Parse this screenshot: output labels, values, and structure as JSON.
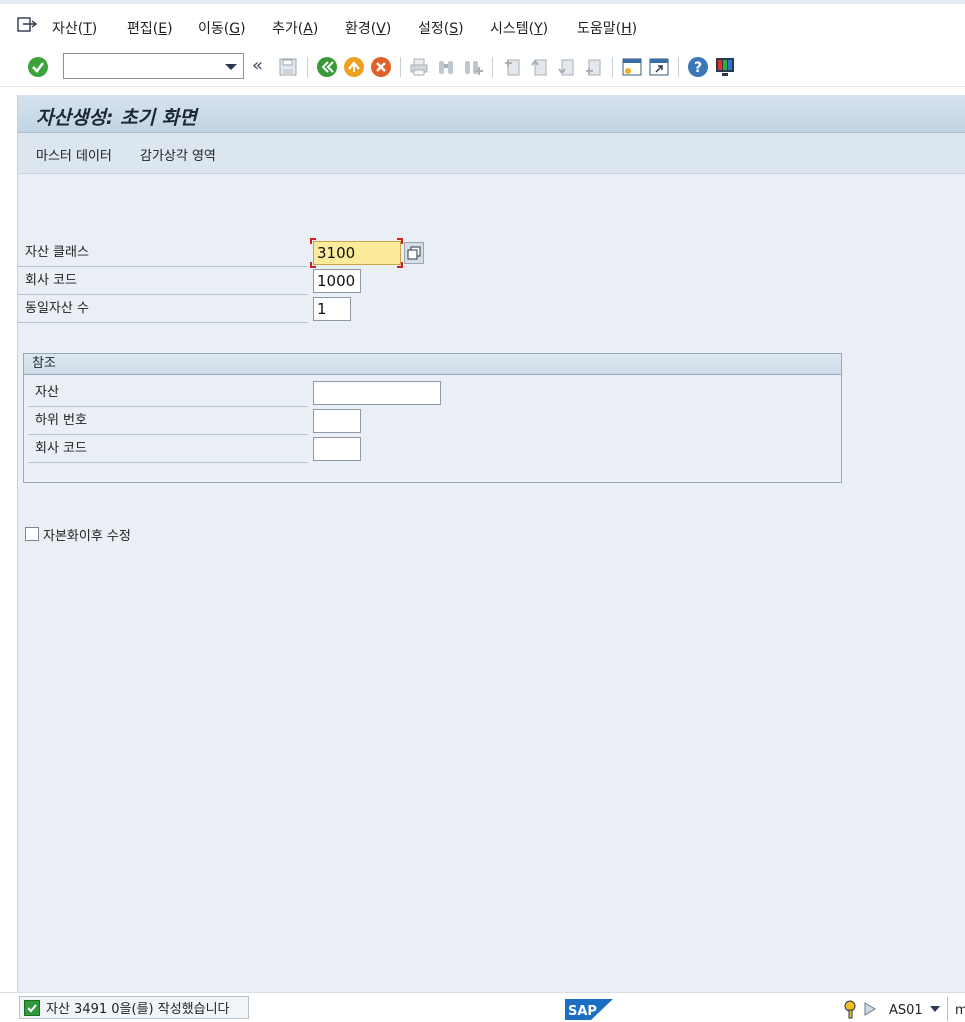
{
  "menubar": {
    "items": [
      {
        "label": "자산(",
        "accel": "T",
        "end": ")"
      },
      {
        "label": "편집(",
        "accel": "E",
        "end": ")"
      },
      {
        "label": "이동(",
        "accel": "G",
        "end": ")"
      },
      {
        "label": "추가(",
        "accel": "A",
        "end": ")"
      },
      {
        "label": "환경(",
        "accel": "V",
        "end": ")"
      },
      {
        "label": "설정(",
        "accel": "S",
        "end": ")"
      },
      {
        "label": "시스템(",
        "accel": "Y",
        "end": ")"
      },
      {
        "label": "도움말(",
        "accel": "H",
        "end": ")"
      }
    ]
  },
  "toolbar": {
    "command_value": "",
    "back_symbol": "«"
  },
  "screen": {
    "title": "자산생성: 초기 화면",
    "app_buttons": [
      "마스터 데이터",
      "감가상각 영역"
    ]
  },
  "fields": {
    "asset_class": {
      "label": "자산 클래스",
      "value": "3100"
    },
    "company_code": {
      "label": "회사 코드",
      "value": "1000"
    },
    "num_similar": {
      "label": "동일자산 수",
      "value": "1"
    }
  },
  "reference": {
    "title": "참조",
    "asset": {
      "label": "자산",
      "value": ""
    },
    "sub_number": {
      "label": "하위 번호",
      "value": ""
    },
    "company_code": {
      "label": "회사 코드",
      "value": ""
    }
  },
  "options": {
    "post_cap_label": "자본화이후 수정",
    "post_cap_checked": false
  },
  "statusbar": {
    "message": "자산 3491 0을(를) 작성했습니다",
    "logo_text": "SAP",
    "transaction": "AS01",
    "more": "m"
  },
  "colors": {
    "title_bar": "#c8d8e6",
    "content_bg": "#e9eff5",
    "required_bg": "#fbeb9b",
    "success": "#2e9a3a"
  }
}
